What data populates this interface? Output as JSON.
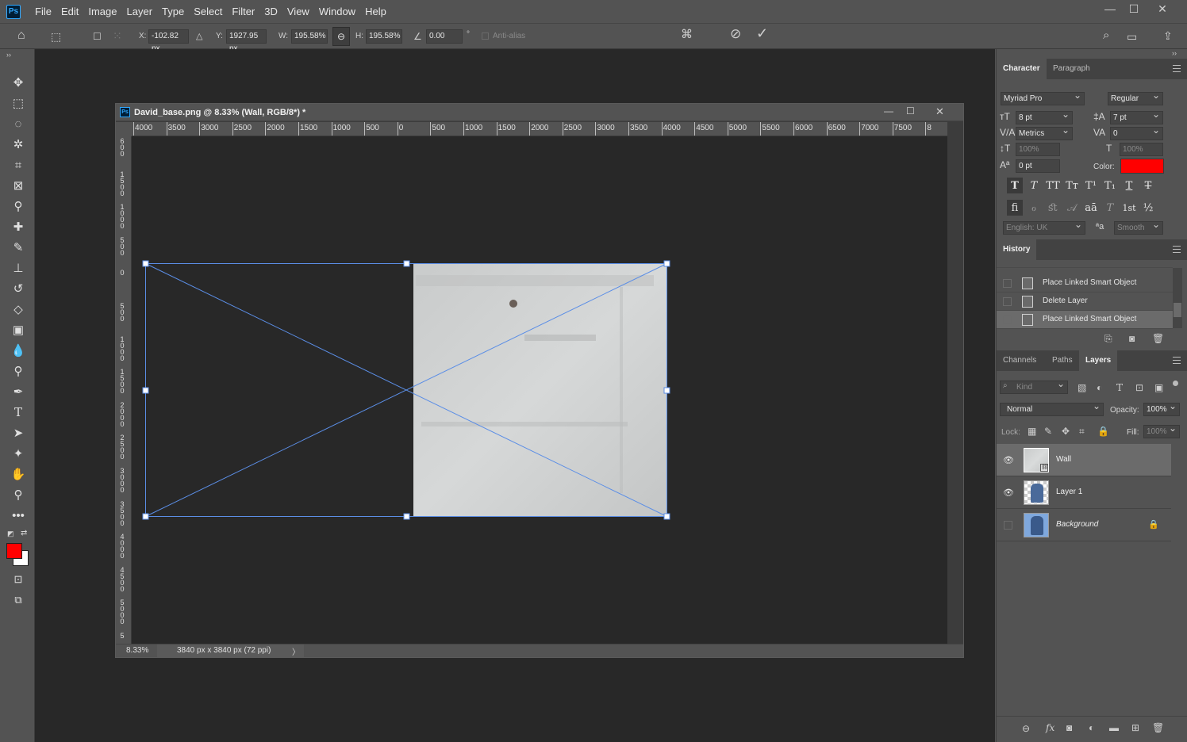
{
  "app": {
    "logo": "Ps"
  },
  "menu": [
    "File",
    "Edit",
    "Image",
    "Layer",
    "Type",
    "Select",
    "Filter",
    "3D",
    "View",
    "Window",
    "Help"
  ],
  "window_controls": {
    "minimize": "—",
    "maximize": "☐",
    "close": "✕"
  },
  "options_bar": {
    "x_label": "X:",
    "x_value": "-102.82 px",
    "y_label": "Y:",
    "y_value": "1927.95 px",
    "w_label": "W:",
    "w_value": "195.58%",
    "h_label": "H:",
    "h_value": "195.58%",
    "rotate_value": "0.00",
    "degree": "°",
    "antialias_label": "Anti-alias"
  },
  "document": {
    "title": "David_base.png @ 8.33% (Wall, RGB/8*) *",
    "zoom": "8.33%",
    "dimensions": "3840 px x 3840 px (72 ppi)",
    "nav_arrow": "〉",
    "ruler_h": [
      "4000",
      "3500",
      "3000",
      "2500",
      "2000",
      "1500",
      "1000",
      "500",
      "0",
      "500",
      "1000",
      "1500",
      "2000",
      "2500",
      "3000",
      "3500",
      "4000",
      "4500",
      "5000",
      "5500",
      "6000",
      "6500",
      "7000",
      "7500",
      "8"
    ],
    "ruler_v": [
      "6 0 0",
      "1 5 0 0",
      "1 0 0 0",
      "5 0 0",
      "0",
      "5 0 0",
      "1 0 0 0",
      "1 5 0 0",
      "2 0 0 0",
      "2 5 0 0",
      "3 0 0 0",
      "3 5 0 0",
      "4 0 0 0",
      "4 5 0 0",
      "5 0 0 0",
      "5"
    ]
  },
  "character_panel": {
    "tabs": [
      "Character",
      "Paragraph"
    ],
    "font_family": "Myriad Pro",
    "font_style": "Regular",
    "font_size": "8 pt",
    "leading": "7 pt",
    "kerning": "Metrics",
    "tracking": "0",
    "vertical_scale": "100%",
    "horizontal_scale": "100%",
    "baseline_shift": "0 pt",
    "color_label": "Color:",
    "color": "#ff0000",
    "style_buttons": [
      "T",
      "T",
      "TT",
      "Tт",
      "T¹",
      "T₁",
      "T",
      "T"
    ],
    "opentype_buttons": [
      "fi",
      "ℴ",
      "ﬆ",
      "𝒜",
      "aā",
      "T",
      "1st",
      "½"
    ],
    "language": "English: UK",
    "aa_icon": "ªa",
    "antialias": "Smooth"
  },
  "history_panel": {
    "title": "History",
    "items": [
      "Place Linked Smart Object",
      "Delete Layer",
      "Place Linked Smart Object"
    ]
  },
  "layers_panel": {
    "tabs": [
      "Channels",
      "Paths",
      "Layers"
    ],
    "filter_kind": "Kind",
    "blend_mode": "Normal",
    "opacity_label": "Opacity:",
    "opacity": "100%",
    "lock_label": "Lock:",
    "fill_label": "Fill:",
    "fill": "100%",
    "layers": [
      {
        "name": "Wall",
        "visible": true
      },
      {
        "name": "Layer 1",
        "visible": true
      },
      {
        "name": "Background",
        "visible": false
      }
    ]
  },
  "colors": {
    "foreground": "#ff0000",
    "background": "#ffffff",
    "accent": "#5b8ee6"
  }
}
